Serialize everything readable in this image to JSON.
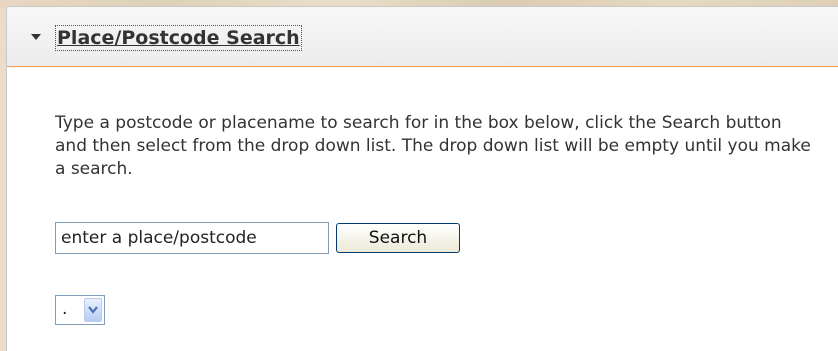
{
  "panel": {
    "title": "Place/Postcode Search"
  },
  "instructions": "Type a postcode or placename to search for in the box below, click the Search button and then select from the drop down list. The drop down list will be empty until you make a search.",
  "search": {
    "input_value": "enter a place/postcode",
    "button_label": "Search"
  },
  "results_select": {
    "selected_value": "."
  },
  "colors": {
    "header_border": "#ff9a4a",
    "input_border": "#7f9db9",
    "button_border": "#003c74",
    "dropdown_arrow": "#4a6fb5"
  },
  "icons": {
    "collapse": "caret-down-icon",
    "dropdown": "chevron-down-icon"
  }
}
